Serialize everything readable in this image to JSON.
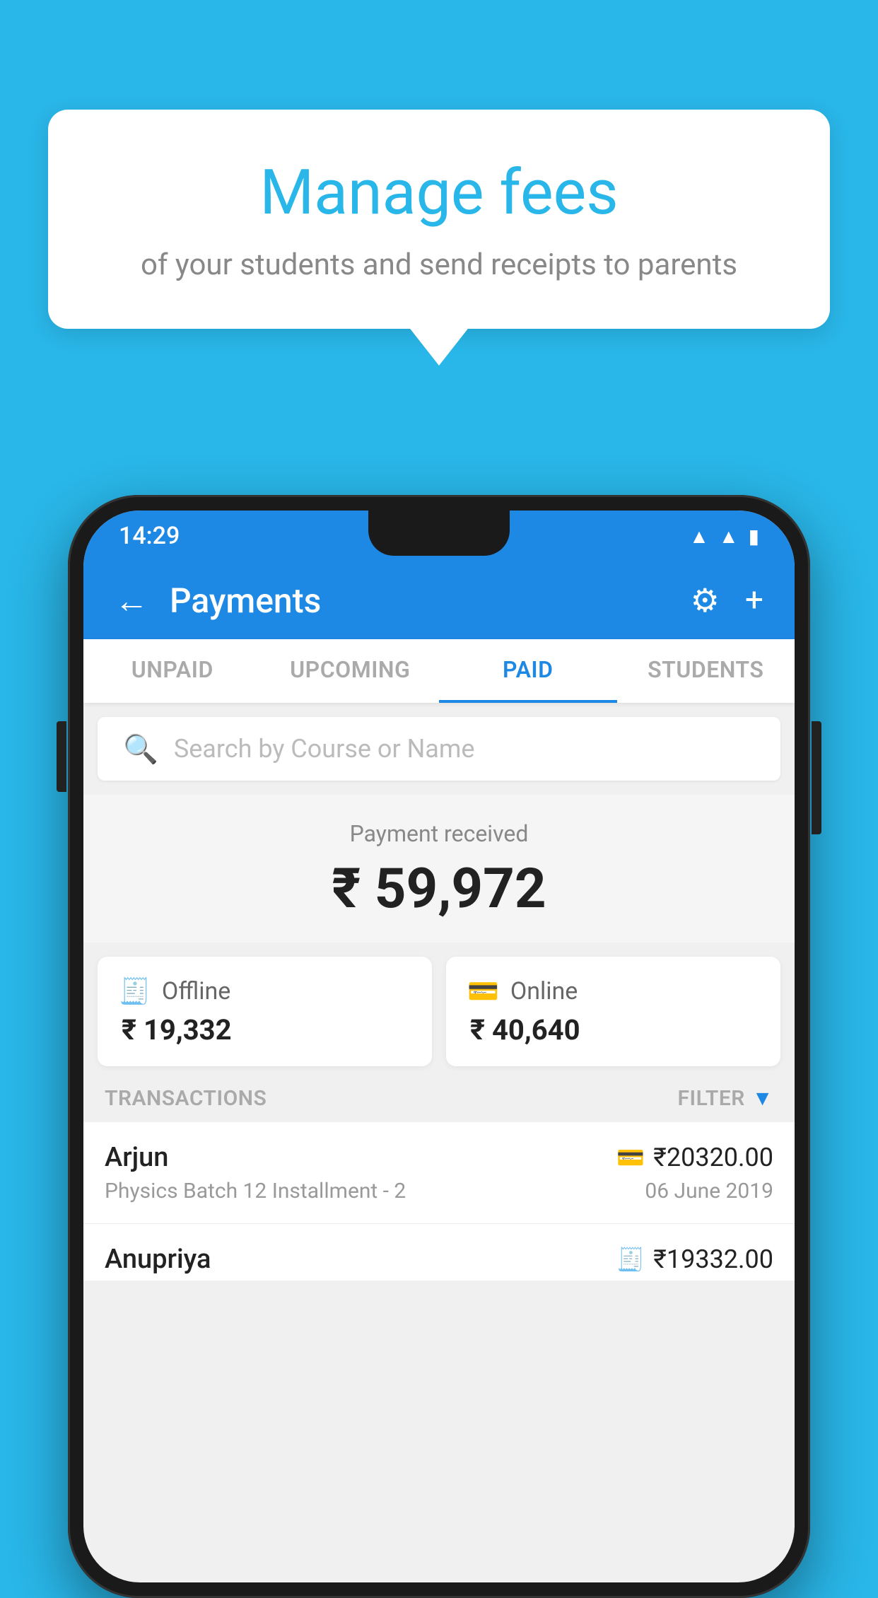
{
  "background_color": "#29b6e8",
  "bubble": {
    "title": "Manage fees",
    "subtitle": "of your students and send receipts to parents"
  },
  "phone": {
    "status_bar": {
      "time": "14:29",
      "icons": [
        "wifi",
        "signal",
        "battery"
      ]
    },
    "header": {
      "title": "Payments",
      "back_label": "←",
      "settings_label": "⚙",
      "add_label": "+"
    },
    "tabs": [
      {
        "label": "UNPAID",
        "active": false
      },
      {
        "label": "UPCOMING",
        "active": false
      },
      {
        "label": "PAID",
        "active": true
      },
      {
        "label": "STUDENTS",
        "active": false
      }
    ],
    "search": {
      "placeholder": "Search by Course or Name"
    },
    "payment_summary": {
      "label": "Payment received",
      "amount": "₹ 59,972",
      "offline_label": "Offline",
      "offline_amount": "₹ 19,332",
      "online_label": "Online",
      "online_amount": "₹ 40,640"
    },
    "transactions": {
      "section_label": "TRANSACTIONS",
      "filter_label": "FILTER",
      "rows": [
        {
          "name": "Arjun",
          "amount": "₹20320.00",
          "sub": "Physics Batch 12 Installment - 2",
          "date": "06 June 2019",
          "payment_type": "online"
        },
        {
          "name": "Anupriya",
          "amount": "₹19332.00",
          "sub": "",
          "date": "",
          "payment_type": "offline"
        }
      ]
    }
  }
}
